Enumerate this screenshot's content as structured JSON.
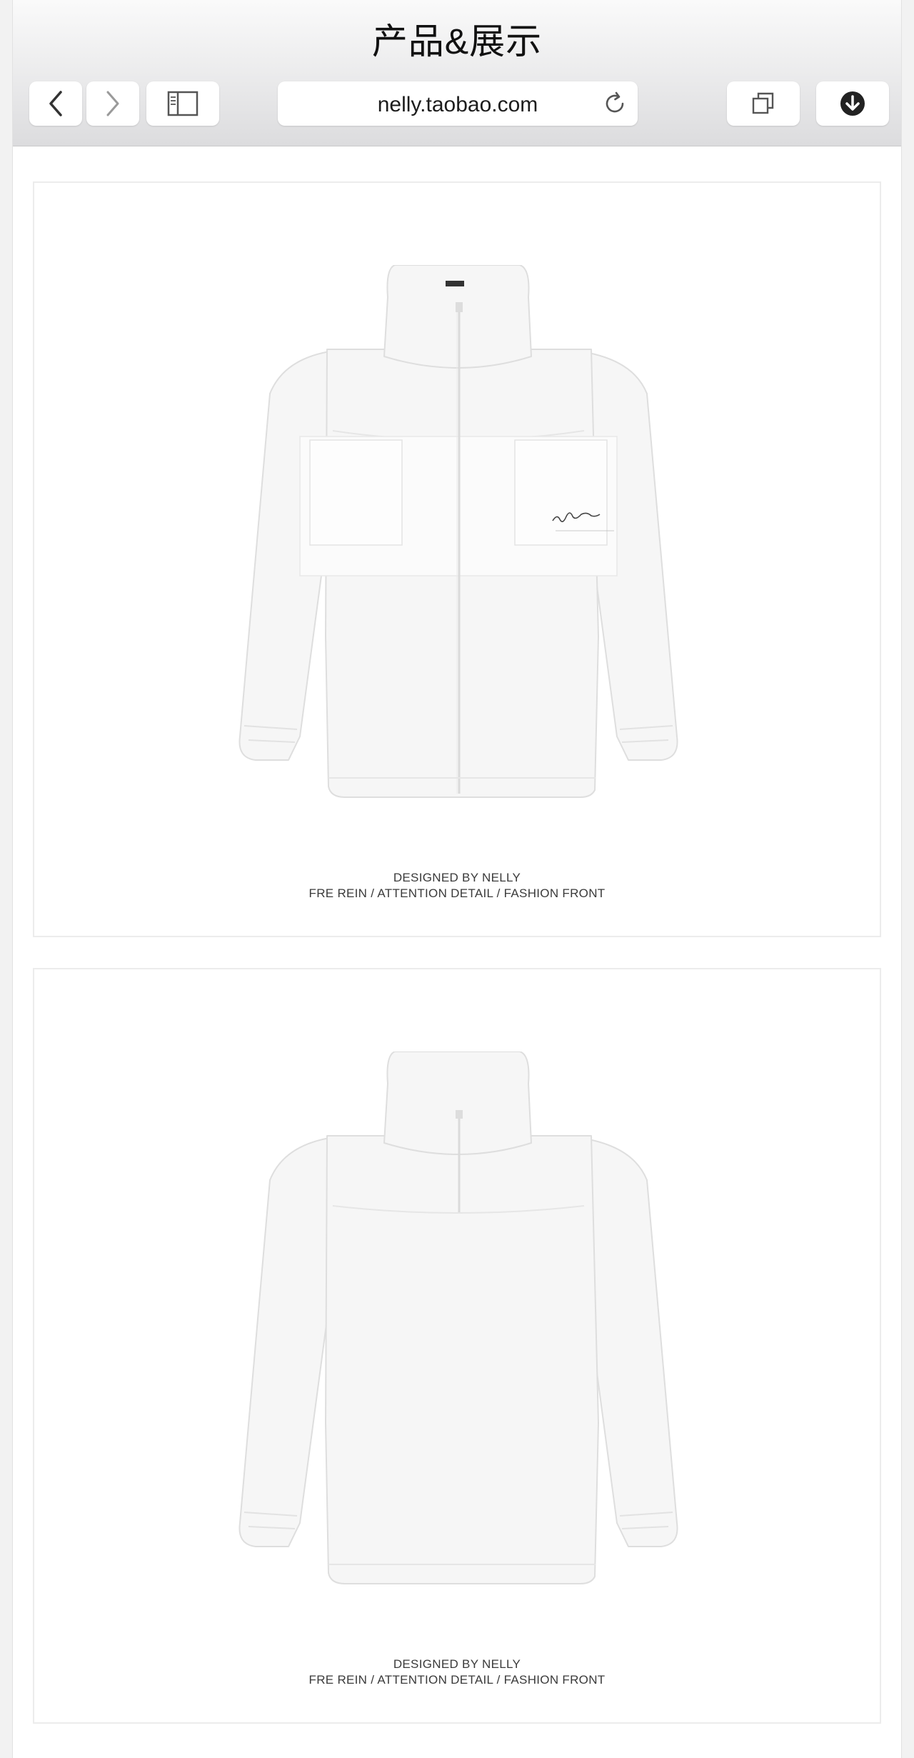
{
  "browser": {
    "title": "产品&展示",
    "url": "nelly.taobao.com",
    "back_icon": "chevron-left-icon",
    "forward_icon": "chevron-right-icon",
    "sidebar_icon": "sidebar-icon",
    "reload_icon": "reload-icon",
    "tabs_icon": "tabs-icon",
    "download_icon": "download-icon"
  },
  "products": [
    {
      "view": "front",
      "caption_line1": "DESIGNED BY NELLY",
      "caption_line2": "FRE REIN / ATTENTION DETAIL / FASHION FRONT"
    },
    {
      "view": "back",
      "caption_line1": "DESIGNED BY NELLY",
      "caption_line2": "FRE REIN / ATTENTION DETAIL / FASHION FRONT"
    }
  ],
  "colors": {
    "garment": "#f5f5f5",
    "card_border": "#ececec",
    "toolbar_top": "#fafafa",
    "toolbar_bottom": "#dcdcde"
  }
}
